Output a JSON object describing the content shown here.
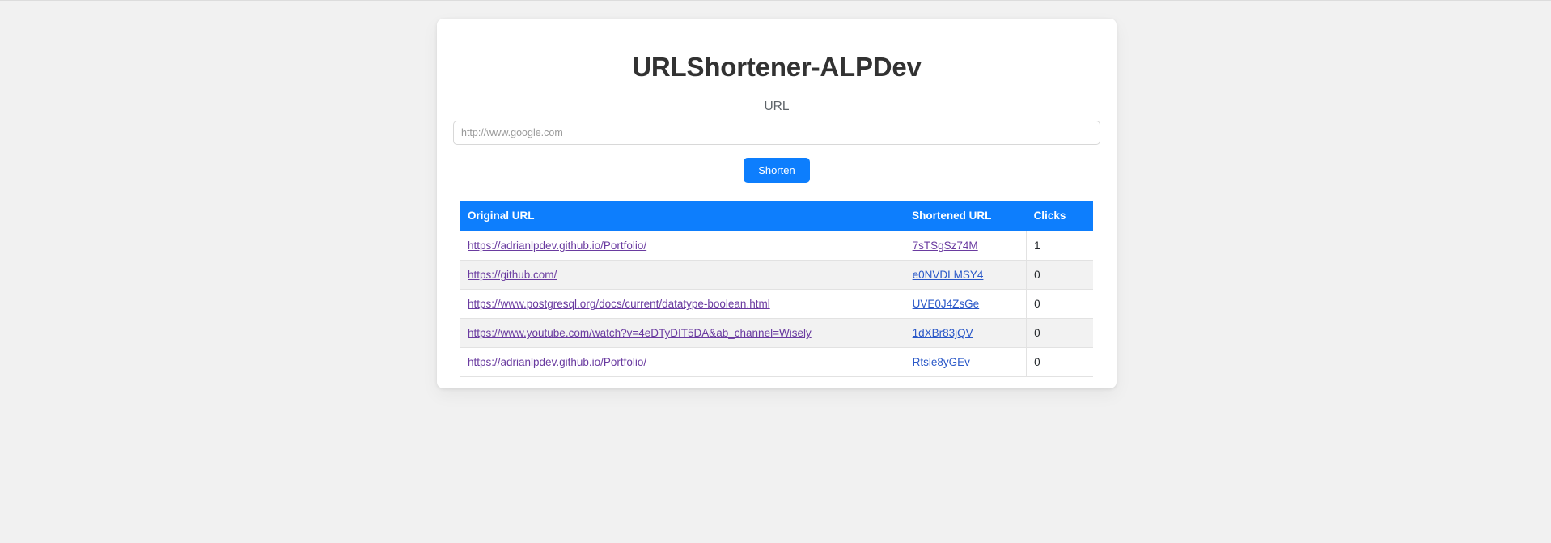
{
  "app": {
    "title": "URLShortener-ALPDev"
  },
  "form": {
    "label": "URL",
    "input_value": "",
    "input_placeholder": "http://www.google.com",
    "submit_label": "Shorten"
  },
  "table": {
    "headers": {
      "original": "Original URL",
      "shortened": "Shortened URL",
      "clicks": "Clicks"
    },
    "rows": [
      {
        "original": "https://adrianlpdev.github.io/Portfolio/",
        "shortened": "7sTSgSz74M",
        "clicks": "1",
        "original_state": "visited",
        "shortened_state": "visited"
      },
      {
        "original": "https://github.com/",
        "shortened": "e0NVDLMSY4",
        "clicks": "0",
        "original_state": "visited",
        "shortened_state": "unvisited"
      },
      {
        "original": "https://www.postgresql.org/docs/current/datatype-boolean.html",
        "shortened": "UVE0J4ZsGe",
        "clicks": "0",
        "original_state": "visited",
        "shortened_state": "unvisited"
      },
      {
        "original": "https://www.youtube.com/watch?v=4eDTyDIT5DA&ab_channel=Wisely",
        "shortened": "1dXBr83jQV",
        "clicks": "0",
        "original_state": "visited",
        "shortened_state": "unvisited"
      },
      {
        "original": "https://adrianlpdev.github.io/Portfolio/",
        "shortened": "Rtsle8yGEv",
        "clicks": "0",
        "original_state": "visited",
        "shortened_state": "unvisited"
      }
    ]
  },
  "colors": {
    "accent": "#0d7efd",
    "page_background": "#f1f1f1",
    "card_background": "#ffffff",
    "visited_link": "#6a3ba0",
    "unvisited_link": "#2a58c8",
    "stripe": "#f2f2f2"
  }
}
